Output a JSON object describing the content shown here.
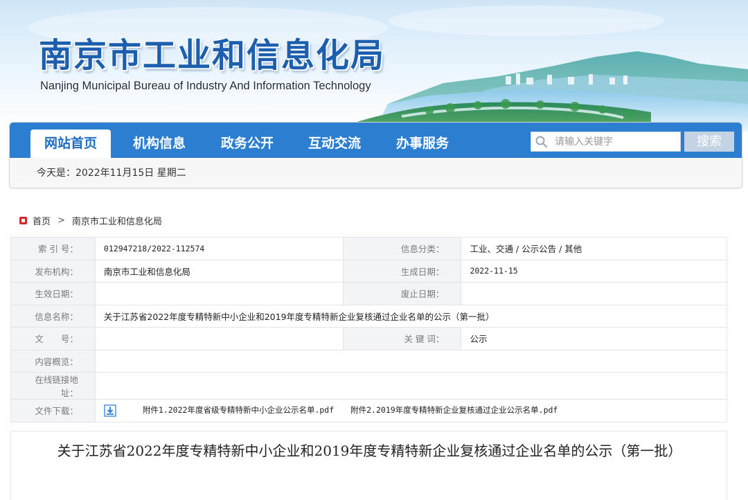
{
  "header": {
    "title": "南京市工业和信息化局",
    "subtitle": "Nanjing Municipal Bureau of Industry And Information Technology"
  },
  "nav": {
    "items": [
      {
        "label": "网站首页",
        "active": true
      },
      {
        "label": "机构信息",
        "active": false
      },
      {
        "label": "政务公开",
        "active": false
      },
      {
        "label": "互动交流",
        "active": false
      },
      {
        "label": "办事服务",
        "active": false
      }
    ],
    "search_placeholder": "请输入关键字",
    "search_button": "搜索"
  },
  "date_line": "今天是：2022年11月15日  星期二",
  "breadcrumb": {
    "home": "首页",
    "separator": ">",
    "current": "南京市工业和信息化局"
  },
  "info": {
    "index_label": "索 引 号：",
    "index_value": "012947218/2022-112574",
    "category_label": "信息分类：",
    "category_value": "工业、交通 / 公示公告 / 其他",
    "publisher_label": "发布机构：",
    "publisher_value": "南京市工业和信息化局",
    "created_label": "生成日期：",
    "created_value": "2022-11-15",
    "effective_label": "生效日期：",
    "effective_value": "",
    "expiry_label": "废止日期：",
    "expiry_value": "",
    "name_label": "信息名称：",
    "name_value": "关于江苏省2022年度专精特新中小企业和2019年度专精特新企业复核通过企业名单的公示（第一批）",
    "docno_label": "文　　号：",
    "docno_value": "",
    "keywords_label": "关 键 词：",
    "keywords_value": "公示",
    "summary_label": "内容概览：",
    "summary_value": "",
    "link_label": "在线链接地址：",
    "link_value": "",
    "download_label": "文件下载：",
    "attachments": [
      "附件1.2022年度省级专精特新中小企业公示名单.pdf",
      "附件2.2019年度专精特新企业复核通过企业公示名单.pdf"
    ]
  },
  "article": {
    "title": "关于江苏省2022年度专精特新中小企业和2019年度专精特新企业复核通过企业名单的公示（第一批）"
  },
  "colors": {
    "nav_blue": "#2c7fd0",
    "title_blue": "#1b5fae",
    "breadcrumb_red": "#d9262c",
    "search_button": "#c4d3e3"
  }
}
